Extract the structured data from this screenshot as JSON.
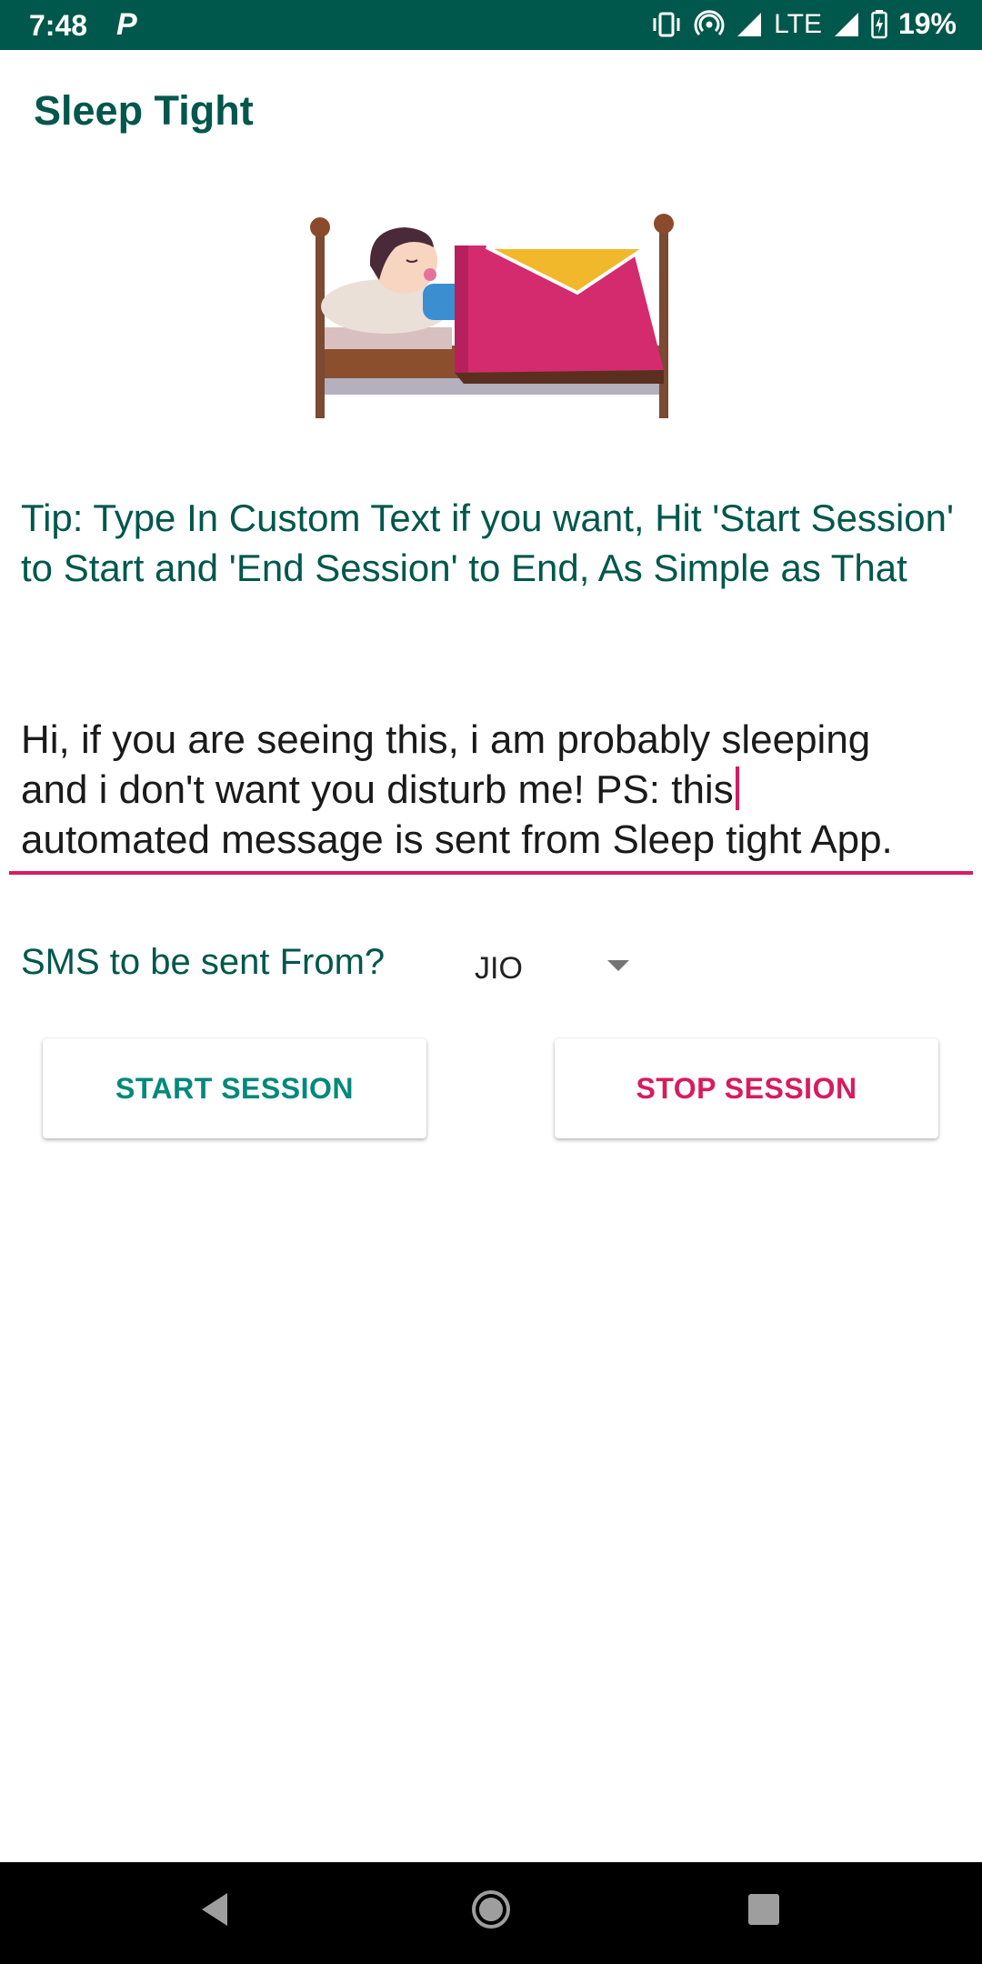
{
  "status_bar": {
    "time": "7:48",
    "notification": "P",
    "network": "LTE",
    "battery": "19%"
  },
  "app": {
    "title": "Sleep Tight"
  },
  "illustration": {
    "icon": "sleeping-child-in-bed"
  },
  "tip": {
    "text": "Tip: Type In Custom Text if you want, Hit 'Start Session' to Start and 'End Session' to End, As Simple as That"
  },
  "message": {
    "line1": "Hi, if you are seeing this, i am probably sleeping",
    "line2": "and i don't want you disturb me! PS: this",
    "line3": "automated message is sent from Sleep tight App."
  },
  "sms": {
    "label": "SMS to be sent From?",
    "selected": "JIO"
  },
  "buttons": {
    "start": "START SESSION",
    "stop": "STOP SESSION"
  },
  "colors": {
    "primary": "#00574b",
    "accent": "#d81b60",
    "start_text": "#00897b"
  }
}
